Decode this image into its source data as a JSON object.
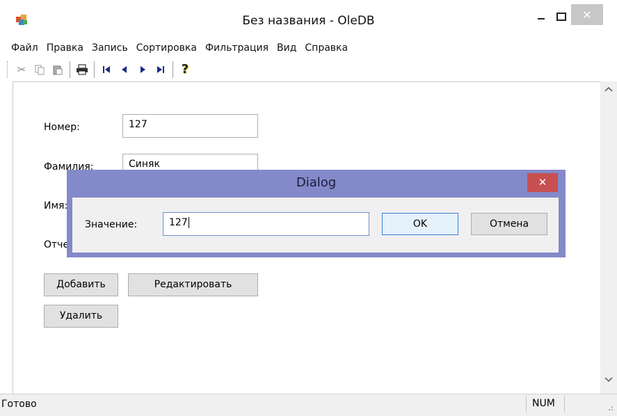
{
  "window": {
    "title": "Без названия - OleDB",
    "minimize": "–",
    "maximize": "□",
    "close": "✕"
  },
  "menu": [
    "Файл",
    "Правка",
    "Запись",
    "Сортировка",
    "Фильтрация",
    "Вид",
    "Справка"
  ],
  "toolbar": {
    "cut": "✂",
    "first": "|◀",
    "prev": "◀",
    "next": "▶",
    "last": "▶|",
    "help": "?"
  },
  "form": {
    "nomer_label": "Номер:",
    "nomer_value": "127",
    "familiya_label": "Фамилия:",
    "familiya_value": "Синяк",
    "imya_label": "Имя:",
    "otch_label": "Отче",
    "add_button": "Добавить",
    "edit_button": "Редактировать",
    "delete_button": "Удалить"
  },
  "dialog": {
    "title": "Dialog",
    "close": "✕",
    "value_label": "Значение:",
    "value": "127",
    "ok": "OK",
    "cancel": "Отмена"
  },
  "scrollbar": {
    "up": "^",
    "down": "v"
  },
  "status": {
    "text": "Готово",
    "num": "NUM"
  }
}
